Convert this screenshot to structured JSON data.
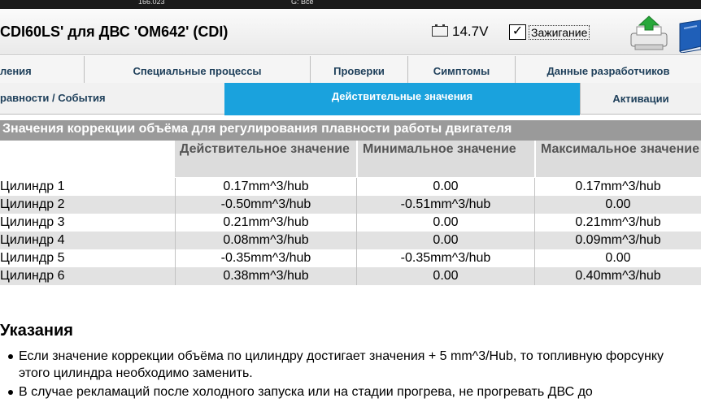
{
  "top_strip": {
    "left_text": "166.023",
    "right_text": "G: Все"
  },
  "header": {
    "title": "CDI60LS' для ДВС 'OM642' (CDI)",
    "voltage": "14.7V",
    "ignition_checked_glyph": "✓",
    "ignition_label": "Зажигание",
    "icons": [
      "battery-icon",
      "print-icon",
      "manual-book-icon"
    ]
  },
  "tabs_row1": [
    {
      "label": "ления"
    },
    {
      "label": "Специальные процессы"
    },
    {
      "label": "Проверки"
    },
    {
      "label": "Симптомы"
    },
    {
      "label": "Данные разработчиков"
    }
  ],
  "tabs_row2": [
    {
      "label": "равности / События"
    },
    {
      "label": "Действительные значения",
      "active": true
    },
    {
      "label": "Активации"
    }
  ],
  "section": {
    "title": "Значения коррекции объёма для регулирования плавности работы двигателя"
  },
  "table": {
    "columns": [
      "",
      "Действительное значение",
      "Минимальное значение",
      "Максимальное значение"
    ],
    "rows": [
      {
        "name": "Цилиндр 1",
        "actual": "0.17mm^3/hub",
        "min": "0.00",
        "max": "0.17mm^3/hub"
      },
      {
        "name": "Цилиндр 2",
        "actual": "-0.50mm^3/hub",
        "min": "-0.51mm^3/hub",
        "max": "0.00"
      },
      {
        "name": "Цилиндр 3",
        "actual": "0.21mm^3/hub",
        "min": "0.00",
        "max": "0.21mm^3/hub"
      },
      {
        "name": "Цилиндр 4",
        "actual": "0.08mm^3/hub",
        "min": "0.00",
        "max": "0.09mm^3/hub"
      },
      {
        "name": "Цилиндр 5",
        "actual": "-0.35mm^3/hub",
        "min": "-0.35mm^3/hub",
        "max": "0.00"
      },
      {
        "name": "Цилиндр 6",
        "actual": "0.38mm^3/hub",
        "min": "0.00",
        "max": "0.40mm^3/hub"
      }
    ]
  },
  "notes": {
    "title": "Указания",
    "items": [
      "Если значение коррекции объёма по цилиндру достигает значения + 5 mm^3/Hub, то топливную форсунку этого цилиндра необходимо заменить.",
      "В случае рекламаций после холодного запуска или на стадии прогрева, не прогревать ДВС до"
    ]
  },
  "colors": {
    "active_tab": "#1aa2dd",
    "section_header": "#9a9a9a",
    "column_header": "#dcdcdc",
    "alt_row": "#e2e2e2",
    "tab_text": "#1e3f5a"
  }
}
